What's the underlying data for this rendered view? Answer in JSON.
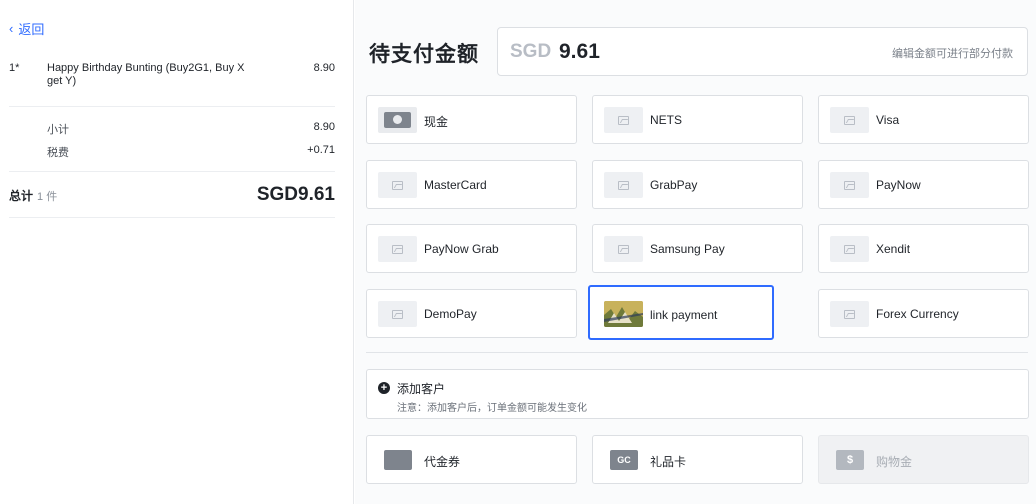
{
  "nav": {
    "back_label": "返回"
  },
  "cart": {
    "items": [
      {
        "qty": "1*",
        "name": "Happy Birthday Bunting (Buy2G1, Buy X get Y)",
        "price": "8.90"
      }
    ],
    "subtotal_label": "小计",
    "subtotal_value": "8.90",
    "tax_label": "税费",
    "tax_value": "+0.71",
    "total_label": "总计",
    "total_count": "1 件",
    "total_value": "SGD9.61"
  },
  "payment": {
    "title": "待支付金额",
    "currency": "SGD",
    "amount": "9.61",
    "hint": "编辑金额可进行部分付款",
    "methods": [
      {
        "label": "现金",
        "icon": "cash-icon"
      },
      {
        "label": "NETS",
        "icon": "image-placeholder-icon"
      },
      {
        "label": "Visa",
        "icon": "image-placeholder-icon"
      },
      {
        "label": "MasterCard",
        "icon": "image-placeholder-icon"
      },
      {
        "label": "GrabPay",
        "icon": "image-placeholder-icon"
      },
      {
        "label": "PayNow",
        "icon": "image-placeholder-icon"
      },
      {
        "label": "PayNow Grab",
        "icon": "image-placeholder-icon"
      },
      {
        "label": "Samsung Pay",
        "icon": "image-placeholder-icon"
      },
      {
        "label": "Xendit",
        "icon": "image-placeholder-icon"
      },
      {
        "label": "DemoPay",
        "icon": "image-placeholder-icon"
      },
      {
        "label": "link payment",
        "icon": "link-payment-image-icon",
        "selected": true
      },
      {
        "label": "Forex Currency",
        "icon": "image-placeholder-icon"
      }
    ]
  },
  "customer": {
    "add_label": "添加客户",
    "note": "注意：添加客户后，订单金额可能发生变化"
  },
  "extras": [
    {
      "label": "代金券",
      "icon": "voucher-icon",
      "glyph": ""
    },
    {
      "label": "礼品卡",
      "icon": "gift-card-icon",
      "glyph": "GC"
    },
    {
      "label": "购物金",
      "icon": "store-credit-icon",
      "glyph": "$",
      "disabled": true
    }
  ],
  "colors": {
    "accent": "#2f6bff",
    "text": "#1f2329",
    "border": "#dcdfe3"
  }
}
